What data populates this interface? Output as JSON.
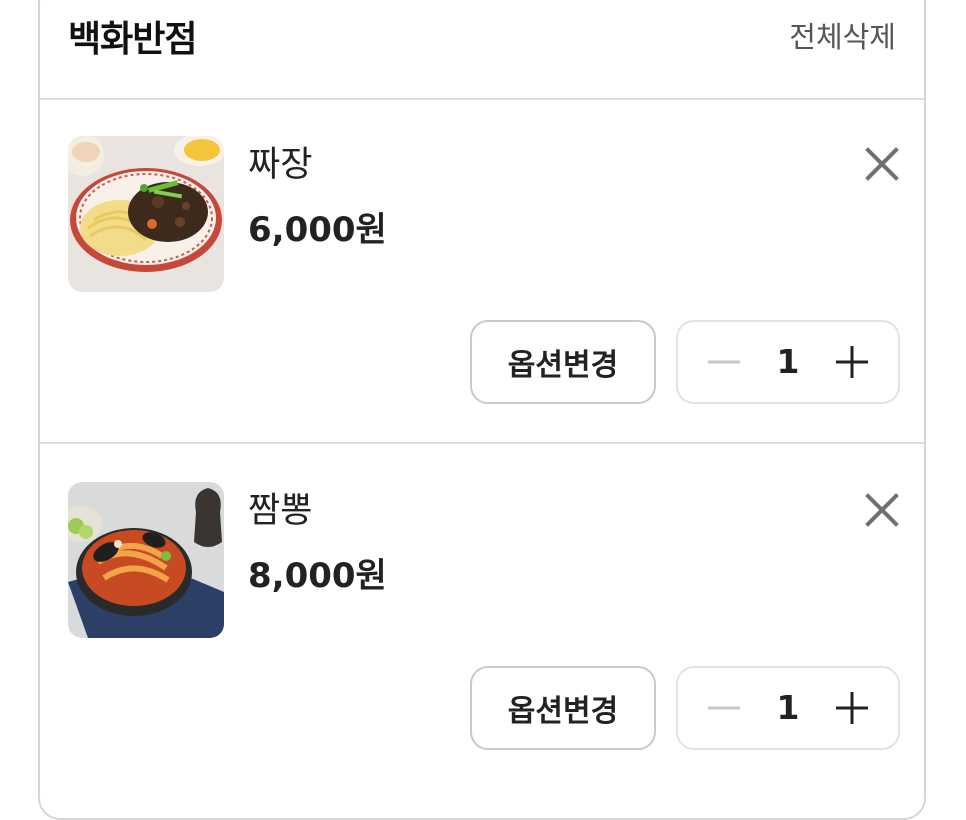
{
  "store": {
    "name": "백화반점",
    "delete_all_label": "전체삭제"
  },
  "items": [
    {
      "name": "짜장",
      "price": "6,000원",
      "option_label": "옵션변경",
      "quantity": "1",
      "image_icon": "jajangmyeon-photo"
    },
    {
      "name": "짬뽕",
      "price": "8,000원",
      "option_label": "옵션변경",
      "quantity": "1",
      "image_icon": "jjamppong-photo"
    }
  ],
  "colors": {
    "border": "#d6d6d6",
    "divider": "#dedede",
    "text": "#222222",
    "muted": "#555555",
    "disabled": "#c8c8c8"
  }
}
